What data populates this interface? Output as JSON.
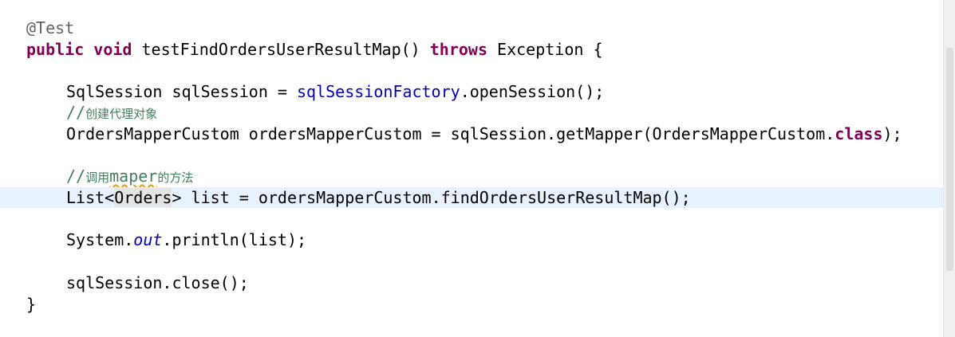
{
  "editor": {
    "lines": {
      "l1": {
        "annotation": "@Test"
      },
      "l2": {
        "kw_public": "public",
        "kw_void": "void",
        "method_name": " testFindOrdersUserResultMap() ",
        "kw_throws": "throws",
        "rest": " Exception {"
      },
      "l3": {
        "prefix": "SqlSession sqlSession = ",
        "field": "sqlSessionFactory",
        "suffix": ".openSession();"
      },
      "l4": {
        "slashes": "//",
        "text": "创建代理对象"
      },
      "l5": {
        "prefix": "OrdersMapperCustom ordersMapperCustom = sqlSession.getMapper(OrdersMapperCustom.",
        "kw_class": "class",
        "suffix": ");"
      },
      "l6": {
        "slashes": "//",
        "text_a": "调用",
        "text_b": "maper",
        "text_c": "的方法"
      },
      "l7": {
        "prefix": "List<",
        "highlight": "Orders",
        "suffix": "> list = ordersMapperCustom.findOrdersUserResultMap();"
      },
      "l8": {
        "prefix": "System.",
        "static_field": "out",
        "suffix": ".println(list);"
      },
      "l9": {
        "code": "sqlSession.close();"
      },
      "l10": {
        "code": "}"
      }
    },
    "colors": {
      "keyword": "#7f0055",
      "field": "#0000c0",
      "comment": "#3f7f5f",
      "annotation": "#646464",
      "current_line": "#e8f2fe"
    }
  }
}
